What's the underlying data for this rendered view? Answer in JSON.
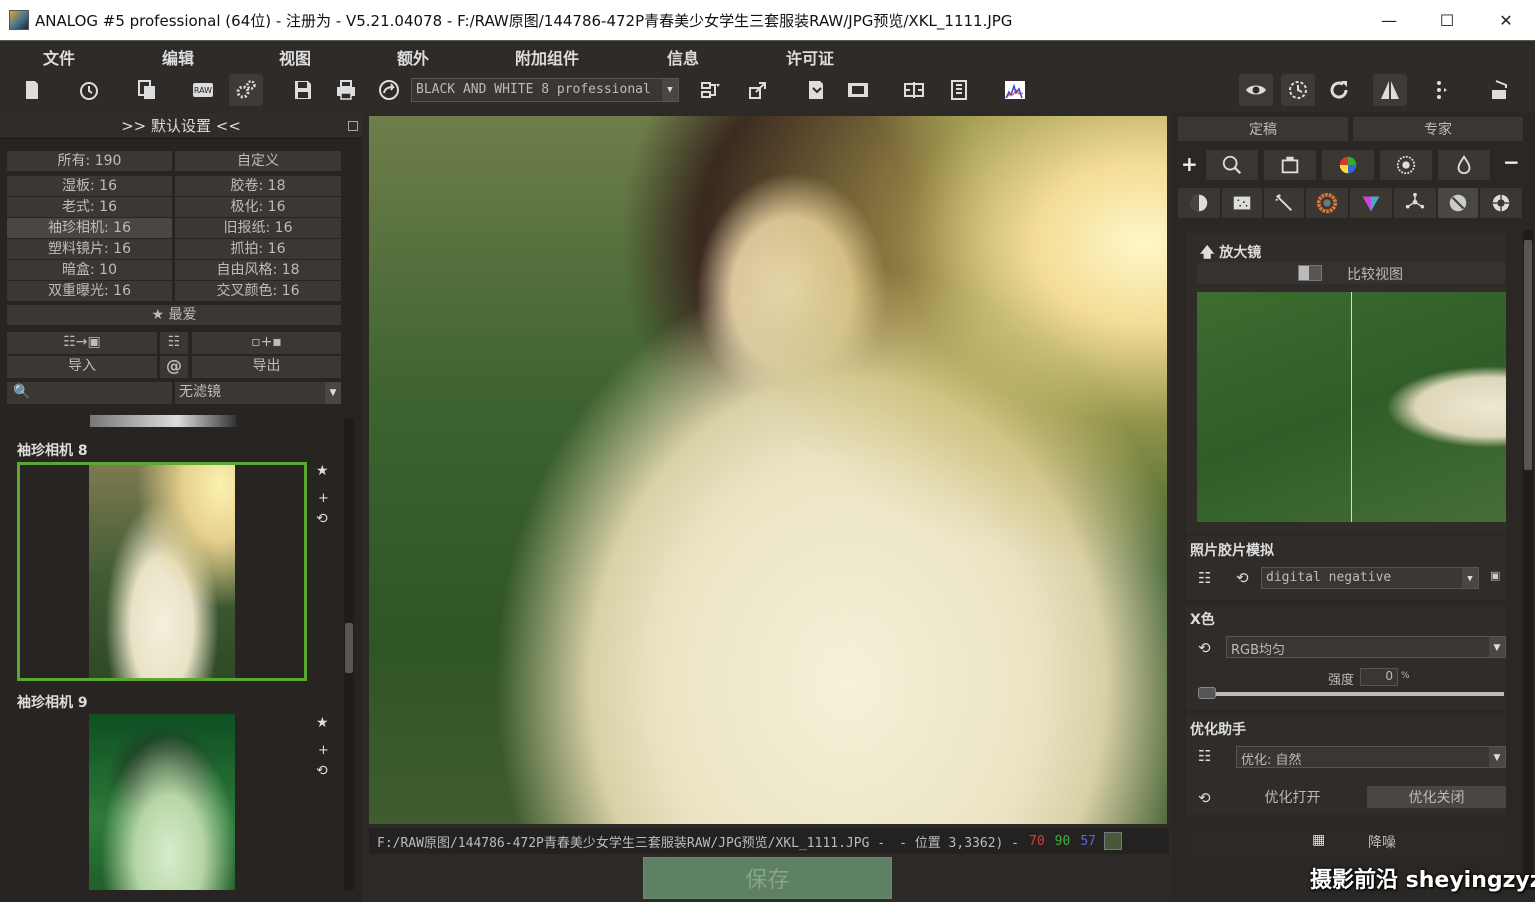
{
  "window": {
    "title": "ANALOG #5 professional (64位) - 注册为 - V5.21.04078 - F:/RAW原图/144786-472P青春美少女学生三套服装RAW/JPG预览/XKL_1111.JPG",
    "min": "—",
    "max": "☐",
    "close": "✕"
  },
  "menu": [
    "文件",
    "编辑",
    "视图",
    "额外",
    "附加组件",
    "信息",
    "许可证"
  ],
  "toolbar": {
    "preset": "BLACK AND WHITE 8 professional"
  },
  "left": {
    "header": ">> 默认设置 <<",
    "categories": [
      [
        "所有: 190",
        "自定义"
      ],
      [
        "湿板: 16",
        "胶卷: 18"
      ],
      [
        "老式: 16",
        "极化: 16"
      ],
      [
        "袖珍相机: 16",
        "旧报纸: 16"
      ],
      [
        "塑料镜片: 16",
        "抓拍: 16"
      ],
      [
        "暗盒: 10",
        "自由风格: 18"
      ],
      [
        "双重曝光: 16",
        "交叉颜色: 16"
      ]
    ],
    "favorites": "★ 最爱",
    "import": "导入",
    "at": "@",
    "export": "导出",
    "filter": "无滤镜",
    "film1": "袖珍相机 8",
    "film2": "袖珍相机 9"
  },
  "status": {
    "path": "F:/RAW原图/144786-472P青春美少女学生三套服装RAW/JPG预览/XKL_1111.JPG -",
    "pos": "- 位置 3,3362) -",
    "r": "70",
    "g": "90",
    "b": "57"
  },
  "save": "保存",
  "right": {
    "tab1": "定稿",
    "tab2": "专家",
    "magnifier": "放大镜",
    "compare": "比较视图",
    "film_sim": "照片胶片模拟",
    "film_sim_value": "digital negative",
    "bw": "X色",
    "bw_value": "RGB均匀",
    "strength_label": "强度",
    "strength_value": "0",
    "strength_unit": "%",
    "strength_level": 0,
    "optimize": "优化助手",
    "optimize_value": "优化: 自然",
    "opt_on": "优化打开",
    "opt_off": "优化关闭",
    "denoise": "降噪"
  },
  "watermark": "摄影前沿 sheyingzyz.com",
  "colors": {
    "r": "#d04040",
    "g": "#3fae3f",
    "b": "#5d64d8",
    "accent": "#5aa832"
  }
}
